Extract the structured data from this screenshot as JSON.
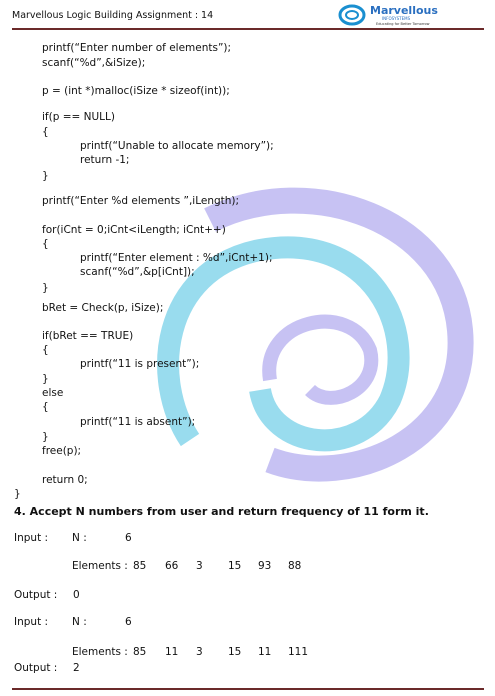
{
  "header": {
    "title": "Marvellous Logic Building Assignment : 14",
    "logo_text": "Marvellous",
    "logo_sub": "INFOSYSTEMS",
    "logo_tag": "Educating for Better Tomorrow"
  },
  "code": [
    "printf(“Enter number of elements”);",
    "scanf(“%d”,&iSize);",
    "p = (int *)malloc(iSize * sizeof(int));",
    "if(p == NULL)",
    "{",
    "printf(“Unable to allocate memory”);",
    "return -1;",
    "}",
    "printf(“Enter %d elements ”,iLength);",
    "for(iCnt = 0;iCnt<iLength; iCnt++)",
    "{",
    "printf(“Enter element : %d”,iCnt+1);",
    "scanf(“%d”,&p[iCnt]);",
    "}",
    "bRet = Check(p, iSize);",
    "if(bRet == TRUE)",
    "{",
    "printf(“11 is present”);",
    "}",
    "else",
    "{",
    "printf(“11 is absent”);",
    "}",
    "free(p);",
    "return 0;",
    "}"
  ],
  "question": "4. Accept N numbers from user and return frequency of 11 form it.",
  "examples": [
    {
      "input_label": "Input :",
      "n_label": "N :",
      "n": "6",
      "elements_label": "Elements :",
      "elements": [
        "85",
        "66",
        "3",
        "15",
        "93",
        "88"
      ],
      "output_label": "Output :",
      "output": "0"
    },
    {
      "input_label": "Input :",
      "n_label": "N :",
      "n": "6",
      "elements_label": "Elements :",
      "elements": [
        "85",
        "11",
        "3",
        "15",
        "11",
        "111"
      ],
      "output_label": "Output :",
      "output": "2"
    }
  ],
  "colors": {
    "rule": "#6b2a2a",
    "watermark_blue": "#7fd3ea",
    "watermark_violet": "#b9b3f0"
  }
}
